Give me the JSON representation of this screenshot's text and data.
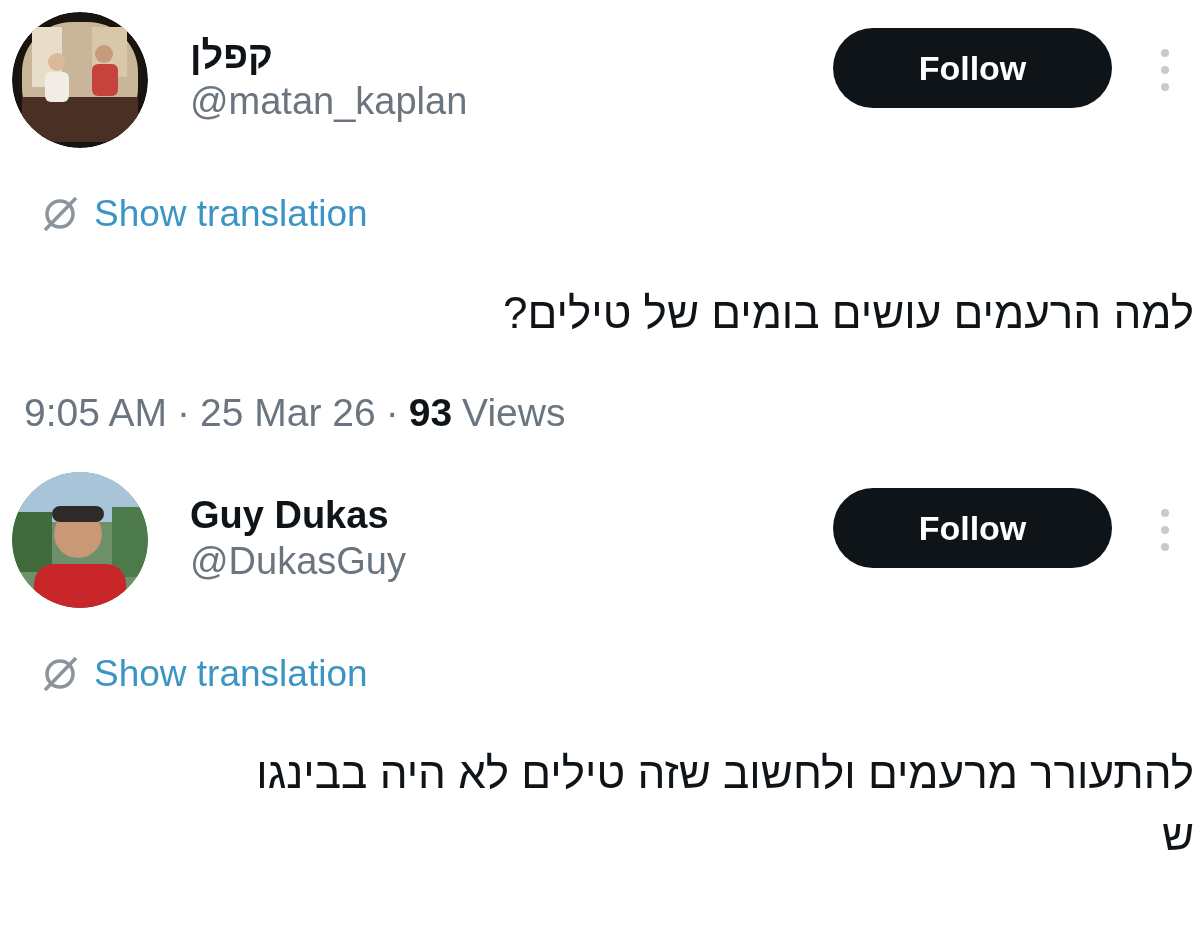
{
  "tweets": [
    {
      "author": {
        "name": "קפלן",
        "handle": "@matan_kaplan"
      },
      "follow_button": "Follow",
      "translation_link": "Show translation",
      "body": [
        "למה הרעמים עושים בומים של טילים?"
      ],
      "meta": {
        "time": "9:05 AM",
        "separator": "·",
        "date": "25 Mar 26",
        "views_count": "93",
        "views_label": "Views"
      }
    },
    {
      "author": {
        "name": "Guy Dukas",
        "handle": "@DukasGuy"
      },
      "follow_button": "Follow",
      "translation_link": "Show translation",
      "body": [
        "להתעורר מרעמים ולחשוב שזה טילים לא היה בבינגו",
        "ש"
      ]
    }
  ]
}
